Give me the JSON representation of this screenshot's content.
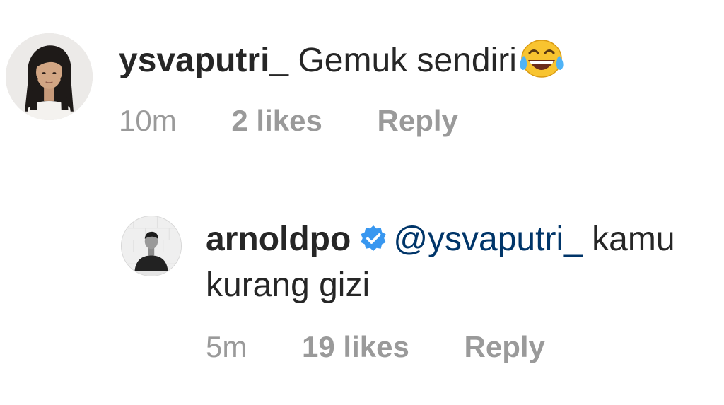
{
  "comments": [
    {
      "username": "ysvaputri_",
      "text": "Gemuk sendiri",
      "emoji": "face-with-tears-of-joy",
      "time": "10m",
      "likes": "2 likes",
      "reply": "Reply"
    },
    {
      "username": "arnoldpo",
      "verified": true,
      "mention": "@ysvaputri_",
      "text_line1": "kamu",
      "text_line2": "kurang gizi",
      "time": "5m",
      "likes": "19 likes",
      "reply": "Reply"
    }
  ],
  "colors": {
    "text": "#262626",
    "meta": "#9a9a9a",
    "mention": "#003569",
    "verified": "#3897f0"
  }
}
